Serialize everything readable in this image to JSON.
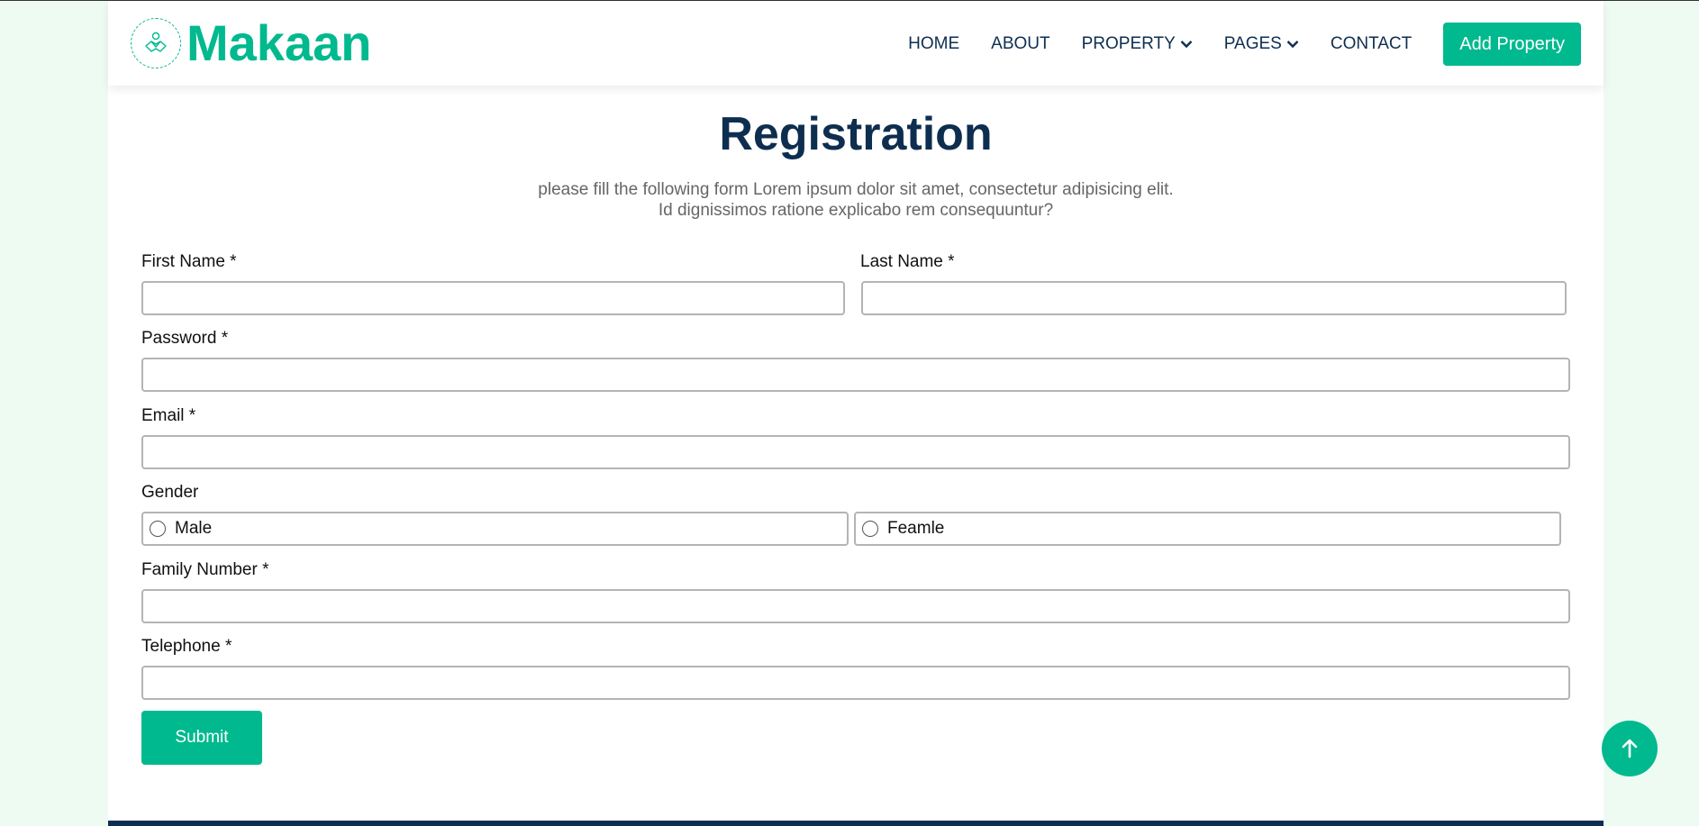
{
  "brand": {
    "name": "Makaan",
    "logo_icon": "handshake-icon",
    "color": "#00b98e"
  },
  "nav": {
    "items": [
      {
        "label": "HOME"
      },
      {
        "label": "ABOUT"
      },
      {
        "label": "PROPERTY",
        "dropdown": true
      },
      {
        "label": "PAGES",
        "dropdown": true
      },
      {
        "label": "CONTACT"
      }
    ],
    "cta": "Add Property"
  },
  "page": {
    "title": "Registration",
    "subtitle_line1": "please fill the following form Lorem ipsum dolor sit amet, consectetur adipisicing elit.",
    "subtitle_line2": "Id dignissimos ratione explicabo rem consequuntur?"
  },
  "form": {
    "first_name": {
      "label": "First Name *",
      "value": ""
    },
    "last_name": {
      "label": "Last Name *",
      "value": ""
    },
    "password": {
      "label": "Password *",
      "value": ""
    },
    "email": {
      "label": "Email *",
      "value": ""
    },
    "gender": {
      "label": "Gender",
      "options": [
        "Male",
        "Feamle"
      ]
    },
    "family_number": {
      "label": "Family Number *",
      "value": ""
    },
    "telephone": {
      "label": "Telephone *",
      "value": ""
    },
    "submit": "Submit"
  },
  "colors": {
    "accent": "#00b98e",
    "dark": "#0e2e50",
    "page_bg": "#eefbf3"
  },
  "back_to_top_icon": "arrow-up-icon"
}
